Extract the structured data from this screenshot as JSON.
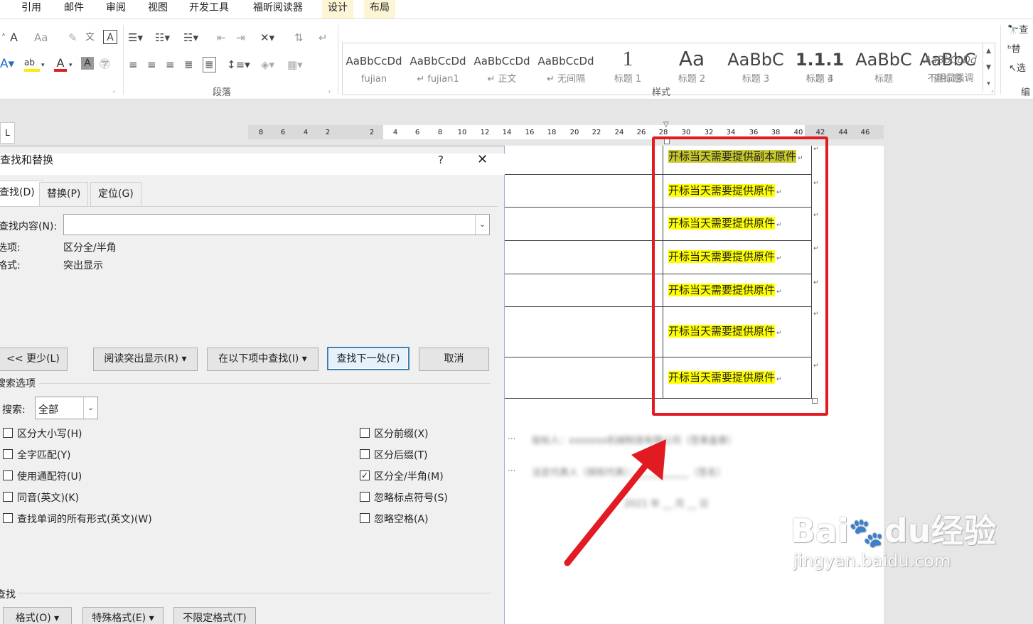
{
  "menubar": {
    "items": [
      "引用",
      "邮件",
      "审阅",
      "视图",
      "开发工具",
      "福昕阅读器",
      "设计",
      "布局"
    ]
  },
  "ribbon": {
    "font_row1": [
      "A",
      "Aa"
    ],
    "paragraph_label": "段落",
    "styles_label": "样式",
    "edit_label": "编",
    "edit_items": [
      "查",
      "替",
      "选"
    ],
    "styles": [
      {
        "preview": "AaBbCcDd",
        "name": "fujian"
      },
      {
        "preview": "AaBbCcDd",
        "name": "↵ fujian1"
      },
      {
        "preview": "AaBbCcDd",
        "name": "↵ 正文"
      },
      {
        "preview": "AaBbCcDd",
        "name": "↵ 无间隔"
      },
      {
        "preview": "1",
        "name": "标题 1"
      },
      {
        "preview": "Aa",
        "name": "标题 2"
      },
      {
        "preview": "AaBbC",
        "name": "标题 3"
      },
      {
        "preview": "1.1.1",
        "name": "标题 4"
      },
      {
        "preview": "AaBbC",
        "name": "标题"
      },
      {
        "preview": "AaBbC",
        "name": "副标题"
      },
      {
        "preview": "AaBbCcDd",
        "name": "不明显强调"
      }
    ]
  },
  "ruler": {
    "ticks": [
      "8",
      "6",
      "4",
      "2",
      "2",
      "4",
      "6",
      "8",
      "10",
      "12",
      "14",
      "16",
      "18",
      "20",
      "22",
      "24",
      "26",
      "28",
      "30",
      "32",
      "34",
      "36",
      "38",
      "40",
      "42",
      "44",
      "46"
    ]
  },
  "document": {
    "cells": [
      "开标当天需要提供副本原件",
      "开标当天需要提供原件",
      "开标当天需要提供原件",
      "开标当天需要提供原件",
      "开标当天需要提供原件",
      "开标当天需要提供原件",
      "开标当天需要提供原件"
    ],
    "blurred_lines": [
      "投标人：xxxxxxx机械制造有限公司（签章盖章）",
      "法定代表人（授权代表）：___________（签名）",
      "2021 年 __ 月 __ 日"
    ],
    "dots": "..."
  },
  "dialog": {
    "title": "查找和替换",
    "help": "?",
    "close": "✕",
    "tabs": [
      "查找(D)",
      "替换(P)",
      "定位(G)"
    ],
    "find_label": "查找内容(N):",
    "find_value": "",
    "options_label": "选项:",
    "options_value": "区分全/半角",
    "format_label": "格式:",
    "format_value": "突出显示",
    "buttons": {
      "less": "<< 更少(L)",
      "reading_highlight": "阅读突出显示(R) ▾",
      "find_in": "在以下项中查找(I) ▾",
      "find_next": "查找下一处(F)",
      "cancel": "取消"
    },
    "search_options_title": "搜索选项",
    "search_label": "搜索:",
    "search_value": "全部",
    "left_checks": [
      {
        "label": "区分大小写(H)",
        "checked": false
      },
      {
        "label": "全字匹配(Y)",
        "checked": false
      },
      {
        "label": "使用通配符(U)",
        "checked": false
      },
      {
        "label": "同音(英文)(K)",
        "checked": false
      },
      {
        "label": "查找单词的所有形式(英文)(W)",
        "checked": false
      }
    ],
    "right_checks": [
      {
        "label": "区分前缀(X)",
        "checked": false
      },
      {
        "label": "区分后缀(T)",
        "checked": false
      },
      {
        "label": "区分全/半角(M)",
        "checked": true
      },
      {
        "label": "忽略标点符号(S)",
        "checked": false
      },
      {
        "label": "忽略空格(A)",
        "checked": false
      }
    ],
    "find_section_title": "查找",
    "bottom_buttons": [
      "格式(O) ▾",
      "特殊格式(E) ▾",
      "不限定格式(T)"
    ]
  },
  "watermark": {
    "brand": "Bai",
    "brand2": "du",
    "brand3": "经验",
    "url": "jingyan.baidu.com"
  },
  "colors": {
    "highlight": "#ffff00",
    "annotation": "#e21b23",
    "accent": "#3c7fb1"
  }
}
